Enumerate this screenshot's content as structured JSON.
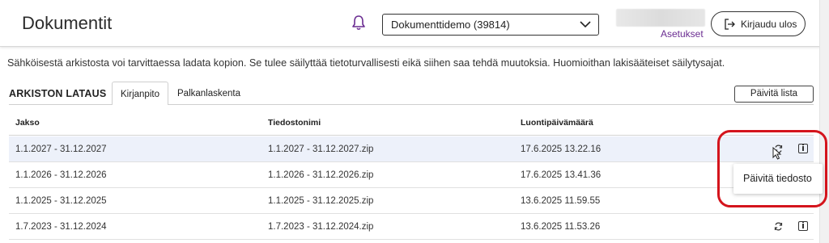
{
  "header": {
    "title": "Dokumentit",
    "notification_icon": "bell-icon",
    "organization_select": {
      "value": "Dokumenttidemo (39814)"
    },
    "settings_link": "Asetukset",
    "logout_button": "Kirjaudu ulos"
  },
  "info_text": "Sähköisestä arkistosta voi tarvittaessa ladata kopion. Se tulee säilyttää tietoturvallisesti eikä siihen saa tehdä muutoksia. Huomioithan lakisääteiset säilytysajat.",
  "archive": {
    "title": "ARKISTON LATAUS",
    "tabs": [
      {
        "label": "Kirjanpito",
        "active": true
      },
      {
        "label": "Palkanlaskenta",
        "active": false
      }
    ],
    "refresh_list_button": "Päivitä lista",
    "table": {
      "columns": [
        "Jakso",
        "Tiedostonimi",
        "Luontipäivämäärä"
      ],
      "rows": [
        {
          "period": "1.1.2027 - 31.12.2027",
          "filename": "1.1.2027 - 31.12.2027.zip",
          "created": "17.6.2025 13.22.16",
          "highlighted": true
        },
        {
          "period": "1.1.2026 - 31.12.2026",
          "filename": "1.1.2026 - 31.12.2026.zip",
          "created": "17.6.2025 13.41.36",
          "highlighted": false
        },
        {
          "period": "1.1.2025 - 31.12.2025",
          "filename": "1.1.2025 - 31.12.2025.zip",
          "created": "13.6.2025 11.59.55",
          "highlighted": false
        },
        {
          "period": "1.7.2023 - 31.12.2024",
          "filename": "1.7.2023 - 31.12.2024.zip",
          "created": "13.6.2025 11.53.26",
          "highlighted": false
        }
      ]
    },
    "tooltip": "Päivitä tiedosto"
  },
  "colors": {
    "link": "#6a2c91",
    "highlight_ring": "#d4141c",
    "row_highlight": "#edf1fa"
  }
}
